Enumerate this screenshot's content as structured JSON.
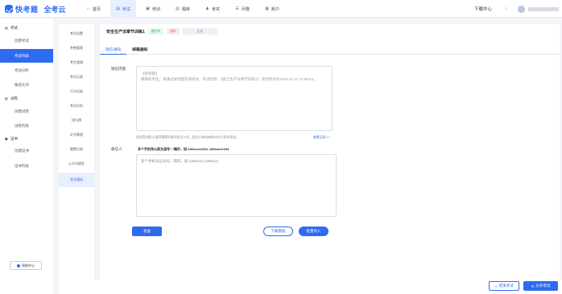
{
  "brand": {
    "name": "快考题",
    "sub": "全考云"
  },
  "nav": [
    {
      "label": "首页",
      "icon": "home-icon",
      "glyph": "⌂"
    },
    {
      "label": "考试",
      "icon": "exam-icon",
      "glyph": "▤",
      "active": true
    },
    {
      "label": "培训",
      "icon": "training-icon",
      "glyph": "▣"
    },
    {
      "label": "题库",
      "icon": "question-bank-icon",
      "glyph": "▥"
    },
    {
      "label": "考实",
      "icon": "practice-icon",
      "glyph": "♟"
    },
    {
      "label": "问卷",
      "icon": "survey-icon",
      "glyph": "☰"
    },
    {
      "label": "账户",
      "icon": "account-icon",
      "glyph": "▦"
    }
  ],
  "header": {
    "download_center": "下载中心"
  },
  "sidebar": {
    "groups": [
      {
        "label": "考试",
        "icon": "exam-group-icon"
      },
      {
        "label": "试卷",
        "icon": "paper-group-icon"
      },
      {
        "label": "证书",
        "icon": "certificate-group-icon"
      }
    ],
    "items": [
      {
        "label": "创建考试"
      },
      {
        "label": "考试列表",
        "active": true
      },
      {
        "label": "考试分析"
      },
      {
        "label": "报名比对"
      },
      {
        "label": "创建试卷"
      },
      {
        "label": "试卷列表"
      },
      {
        "label": "创建证书"
      },
      {
        "label": "证书列表"
      }
    ],
    "help": "帮助中心"
  },
  "subsidebar": [
    {
      "label": "考试设置"
    },
    {
      "label": "考卷管理"
    },
    {
      "label": "考生管理"
    },
    {
      "label": "考试记录"
    },
    {
      "label": "行为记录"
    },
    {
      "label": "考试分析"
    },
    {
      "label": "排行榜"
    },
    {
      "label": "证书管理"
    },
    {
      "label": "缴费记录"
    },
    {
      "label": "公众号绑定"
    },
    {
      "label": "考试通知",
      "active": true
    }
  ],
  "main": {
    "exam_title": "安全生产法章节训练1",
    "tags": {
      "status": "进行中",
      "restrict": "限时",
      "gray": "正式"
    },
    "tabs": [
      {
        "label": "短信通知",
        "active": true
      },
      {
        "label": "邮箱通知"
      }
    ],
    "content_label": "短信内容:",
    "sms_content": "【快考题】\n尊敬的考生，请通过快考题在线考试，考试名称：【安全生产法章节训练1】,考试时间为2021-11-17 14:58:54。",
    "note": "短信签名默认 推荐模版风格不超过70字，超过70按出每条68字分多次发送。",
    "preview_link": "查看记录 >>",
    "recipients_label": "收信人:",
    "recipients_hint": "多个手机号以英文逗号\",\"隔开，如:136xxxx1234, 199xxxx1234",
    "recipients_placeholder": "多个手机号以逗号，隔开，如:136xxxxx,199xxxx",
    "send_button": "发送",
    "download_template": "下载模板",
    "batch_import": "批量导入"
  },
  "footer": {
    "end_exam": "结束考试",
    "share_exam": "分享考试"
  },
  "colors": {
    "primary": "#2e6bf0",
    "green": "#27a35a",
    "red": "#e85454"
  }
}
